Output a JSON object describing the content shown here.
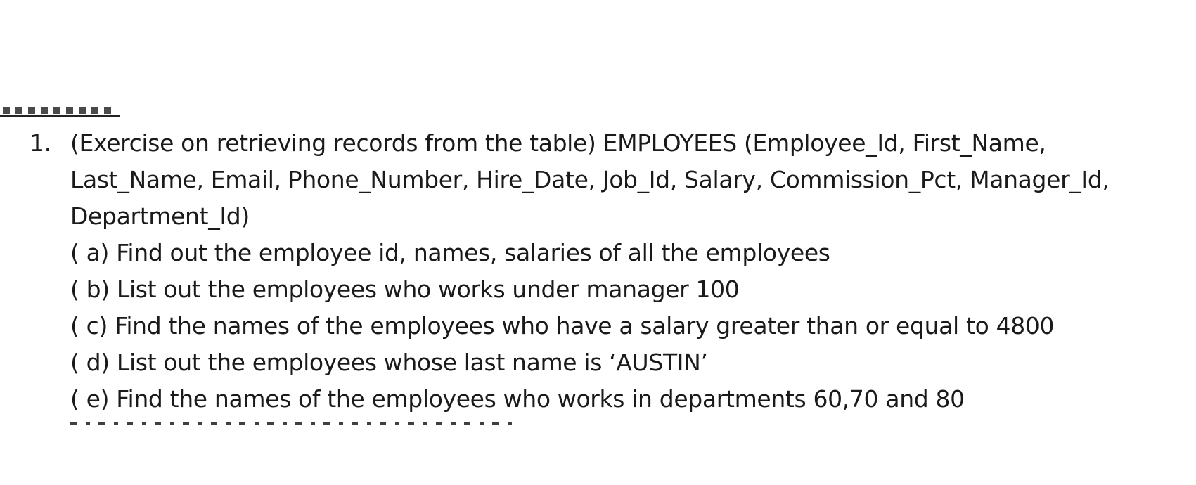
{
  "exercise": {
    "number": "1.",
    "stem": "(Exercise on retrieving records from the table) EMPLOYEES (Employee_Id, First_Name, Last_Name, Email, Phone_Number, Hire_Date, Job_Id, Salary, Commission_Pct, Manager_Id, Department_Id)",
    "parts": [
      "( a) Find out the employee id, names, salaries of all the employees",
      "( b) List out the employees who works under manager 100",
      "( c) Find the names of the employees who have a salary greater than or equal to 4800",
      "( d) List out the employees whose last name is ‘AUSTIN’",
      "( e) Find the names of the employees who works in departments 60,70 and 80"
    ]
  }
}
